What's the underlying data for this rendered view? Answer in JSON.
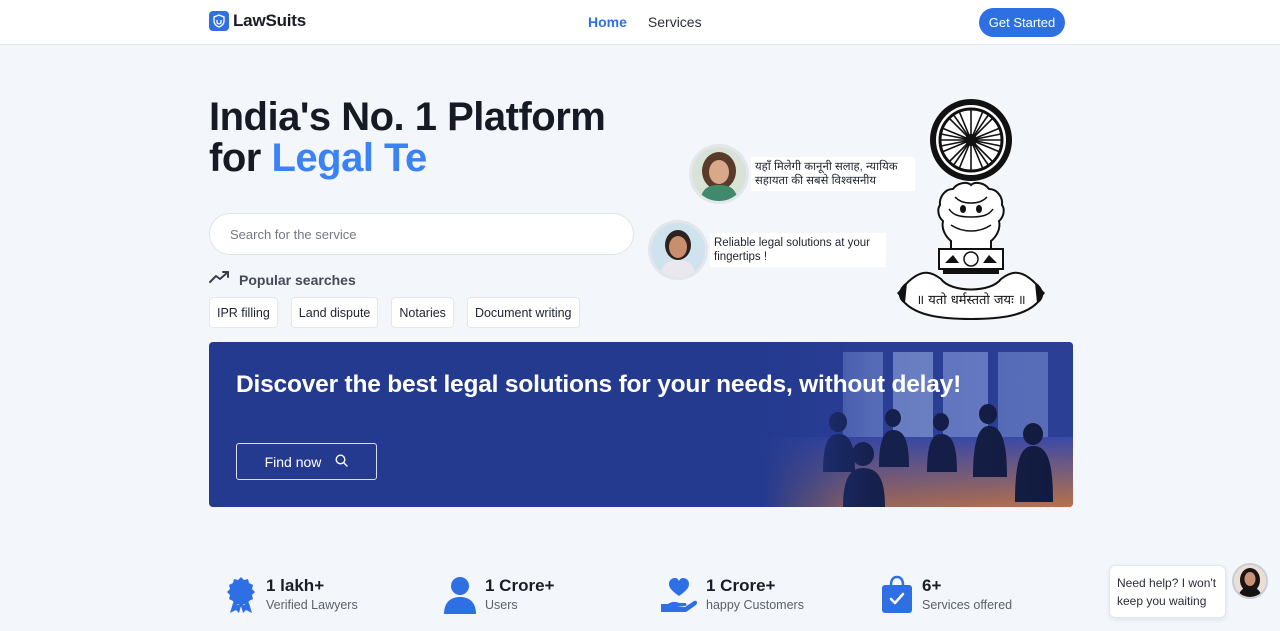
{
  "header": {
    "brand": "LawSuits",
    "nav": [
      {
        "label": "Home",
        "active": true
      },
      {
        "label": "Services",
        "active": false
      }
    ],
    "cta_label": "Get Started"
  },
  "hero": {
    "title_line1": "India's No. 1 Platform",
    "title_line2_prefix": "for",
    "title_line2_accent": "Legal Te",
    "search_placeholder": "Search for the service",
    "popular_label": "Popular searches",
    "chips": [
      "IPR filling",
      "Land dispute",
      "Notaries",
      "Document writing"
    ]
  },
  "testimonials": [
    {
      "text": "यहाँ मिलेगी कानूनी सलाह, न्यायिक सहायता की सबसे विश्वसनीय"
    },
    {
      "text": "Reliable legal solutions at your fingertips !"
    }
  ],
  "emblem": {
    "motto": "॥ यतो धर्मस्ततो जयः ॥"
  },
  "banner": {
    "title": "Discover the best legal solutions for your needs, without delay!",
    "button_label": "Find now"
  },
  "stats": [
    {
      "value": "1 lakh+",
      "label": "Verified Lawyers",
      "icon": "badge-icon"
    },
    {
      "value": "1 Crore+",
      "label": "Users",
      "icon": "user-icon"
    },
    {
      "value": "1 Crore+",
      "label": "happy Customers",
      "icon": "heart-hand-icon"
    },
    {
      "value": "6+",
      "label": "Services offered",
      "icon": "shopping-bag-check-icon"
    }
  ],
  "help": {
    "text": "Need help? I won't keep you waiting"
  },
  "colors": {
    "accent": "#2f6fe4",
    "banner": "#243a8f",
    "background": "#f3f7fc"
  }
}
